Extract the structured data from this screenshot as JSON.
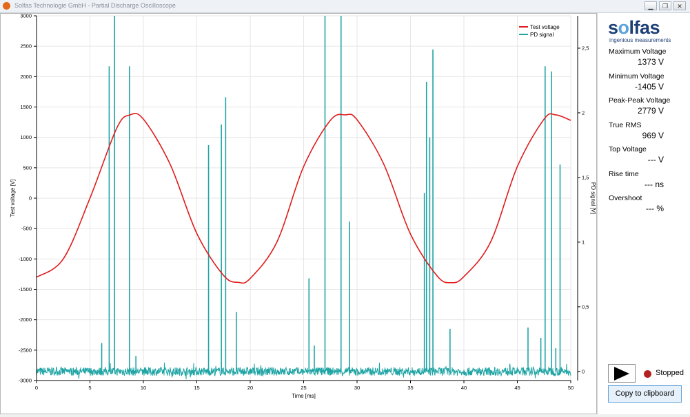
{
  "window": {
    "title": "Solfas Technologie GmbH - Partial Discharge Oscilloscope",
    "buttons": {
      "minimize": "▁",
      "restore": "❐",
      "close": "✕"
    }
  },
  "logo": {
    "brand": "solfas",
    "tagline": "ingenious measurements",
    "brand_color": "#1c3f75",
    "accent_color": "#5aa3d8"
  },
  "measurements": [
    {
      "label": "Maximum Voltage",
      "value": "1373 V"
    },
    {
      "label": "Minimum Voltage",
      "value": "-1405 V"
    },
    {
      "label": "Peak-Peak Voltage",
      "value": "2779 V"
    },
    {
      "label": "True RMS",
      "value": "969 V"
    },
    {
      "label": "Top Voltage",
      "value": "--- V"
    },
    {
      "label": "Rise time",
      "value": "--- ns"
    },
    {
      "label": "Overshoot",
      "value": "--- %"
    }
  ],
  "controls": {
    "play_icon": "play-icon",
    "status": "Stopped",
    "status_color": "#b52020",
    "copy_label": "Copy to clipboard"
  },
  "chart_data": {
    "type": "line",
    "xlabel": "Time [ms]",
    "ylabel": "Test voltage [V]",
    "y2label": "PD signal [V]",
    "xlim": [
      0,
      50
    ],
    "ylim": [
      -3000,
      3000
    ],
    "y2lim": [
      -0.07,
      2.75
    ],
    "xticks": [
      0,
      5,
      10,
      15,
      20,
      25,
      30,
      35,
      40,
      45,
      50
    ],
    "yticks": [
      -3000,
      -2500,
      -2000,
      -1500,
      -1000,
      -500,
      0,
      500,
      1000,
      1500,
      2000,
      2500,
      3000
    ],
    "y2ticks": [
      0,
      0.5,
      1,
      1.5,
      2,
      2.5
    ],
    "y2tick_labels": [
      "0",
      "0,5",
      "1",
      "1,5",
      "2",
      "2,5"
    ],
    "grid": true,
    "legend_position": "top-right",
    "series": [
      {
        "name": "Test voltage",
        "axis": "left",
        "color": "#e01b1b",
        "x": [
          0,
          2.5,
          5,
          7.5,
          8.75,
          10,
          12.5,
          15,
          17.5,
          18.9,
          20,
          22.5,
          25,
          27.5,
          28.9,
          30,
          32.5,
          35,
          37.5,
          38.8,
          40,
          42.5,
          45,
          47.5,
          48.6,
          50
        ],
        "values": [
          -1300,
          -1000,
          0,
          1150,
          1370,
          1300,
          560,
          -580,
          -1270,
          -1385,
          -1320,
          -720,
          520,
          1280,
          1370,
          1290,
          560,
          -590,
          -1280,
          -1390,
          -1290,
          -720,
          520,
          1300,
          1370,
          1280
        ]
      },
      {
        "name": "PD signal",
        "axis": "right",
        "color": "#1fa4a4",
        "baseline": 0,
        "pulses": [
          {
            "t": 6.1,
            "v": 0.22
          },
          {
            "t": 6.8,
            "v": 2.36
          },
          {
            "t": 7.3,
            "v": 2.75
          },
          {
            "t": 8.7,
            "v": 2.36
          },
          {
            "t": 9.3,
            "v": 0.12
          },
          {
            "t": 16.1,
            "v": 1.75
          },
          {
            "t": 17.3,
            "v": 1.91
          },
          {
            "t": 17.7,
            "v": 2.12
          },
          {
            "t": 18.7,
            "v": 0.46
          },
          {
            "t": 25.5,
            "v": 0.72
          },
          {
            "t": 26.0,
            "v": 0.2
          },
          {
            "t": 27.0,
            "v": 2.75
          },
          {
            "t": 28.5,
            "v": 2.75
          },
          {
            "t": 29.3,
            "v": 1.16
          },
          {
            "t": 36.3,
            "v": 1.38
          },
          {
            "t": 36.5,
            "v": 2.24
          },
          {
            "t": 36.8,
            "v": 1.81
          },
          {
            "t": 37.1,
            "v": 2.49
          },
          {
            "t": 38.7,
            "v": 0.33
          },
          {
            "t": 46.0,
            "v": 0.34
          },
          {
            "t": 47.2,
            "v": 0.26
          },
          {
            "t": 47.6,
            "v": 2.36
          },
          {
            "t": 48.2,
            "v": 2.32
          },
          {
            "t": 48.6,
            "v": 0.18
          },
          {
            "t": 49.0,
            "v": 1.6
          }
        ]
      }
    ]
  }
}
